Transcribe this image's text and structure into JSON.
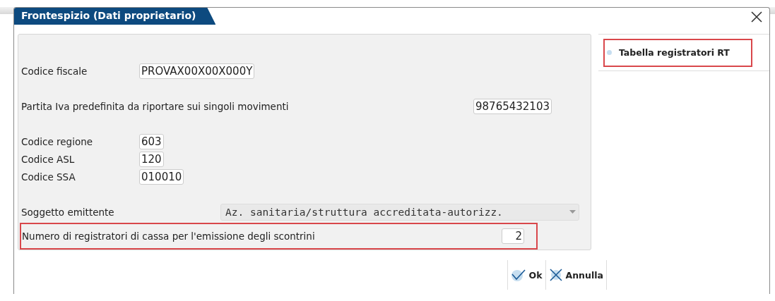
{
  "window": {
    "title": "Frontespizio (Dati proprietario)"
  },
  "form": {
    "groups": [
      [
        {
          "kind": "code",
          "label": "Codice fiscale",
          "value": "PROVAX00X00X000Y",
          "highlighted": false
        }
      ],
      [
        {
          "kind": "vat",
          "label": "Partita Iva predefinita da riportare sui singoli movimenti",
          "value": "98765432103",
          "highlighted": false
        }
      ],
      [
        {
          "kind": "code",
          "label": "Codice regione",
          "value": "603",
          "highlighted": false
        },
        {
          "kind": "code",
          "label": "Codice ASL",
          "value": "120",
          "highlighted": false
        },
        {
          "kind": "code",
          "label": "Codice SSA",
          "value": "010010",
          "highlighted": false
        }
      ],
      [
        {
          "kind": "select",
          "label": "Soggetto emittente",
          "value": "Az. sanitaria/struttura accreditata-autorizz.",
          "highlighted": false
        },
        {
          "kind": "count",
          "label": "Numero di registratori di cassa per l'emissione degli scontrini",
          "value": "2",
          "highlighted": true
        }
      ]
    ]
  },
  "sidebar": {
    "items": [
      {
        "label": "Tabella registratori RT",
        "highlighted": true
      }
    ]
  },
  "buttons": [
    {
      "kind": "ok",
      "label": "Ok"
    },
    {
      "kind": "cancel",
      "label": "Annulla"
    }
  ]
}
